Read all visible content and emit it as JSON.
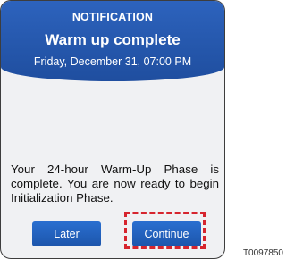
{
  "dialog": {
    "kicker": "NOTIFICATION",
    "title": "Warm up complete",
    "datetime": "Friday, December 31, 07:00 PM",
    "message": "Your 24-hour Warm-Up Phase is complete. You are now ready to begin Initialization Phase.",
    "buttons": {
      "later": "Later",
      "continue": "Continue"
    }
  },
  "annotation": {
    "highlight_color": "#d6252e",
    "reference_code": "T0097850"
  },
  "colors": {
    "header": "#2d63bd",
    "button": "#1f5fbf",
    "background": "#f0f1f3"
  }
}
